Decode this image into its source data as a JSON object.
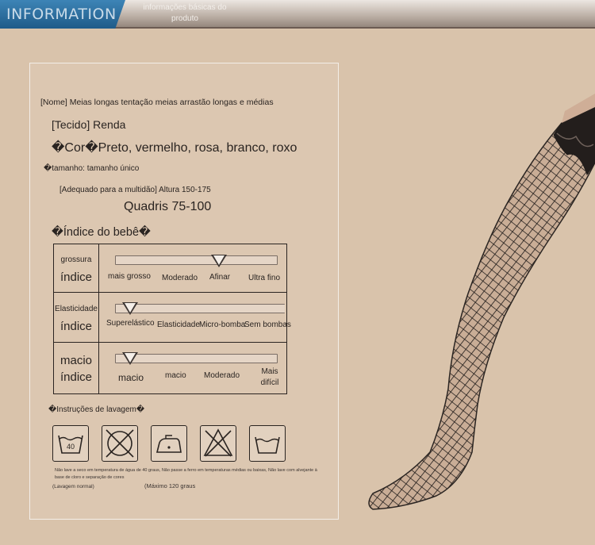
{
  "header": {
    "badge": "INFORMATION",
    "subtitle_line1": "informações básicas do",
    "subtitle_line2": "produto"
  },
  "product": {
    "name": "[Nome] Meias longas tentação meias arrastão longas e médias",
    "fabric": "[Tecido] Renda",
    "color": "�Cor�Preto, vermelho, rosa, branco, roxo",
    "size": "�tamanho: tamanho único",
    "crowd": "[Adequado para a multidão] Altura 150-175",
    "hips": "Quadris 75-100"
  },
  "baby_index": {
    "title": "�Índice do bebê�",
    "rows": [
      {
        "label_top": "grossura",
        "label_bottom": "índice",
        "options": [
          "mais grosso",
          "Moderado",
          "Afinar",
          "Ultra fino"
        ],
        "selected": 2
      },
      {
        "label_top": "Elasticidade",
        "label_bottom": "índice",
        "options": [
          "Superelástico",
          "Elasticidade",
          "Micro-bomba",
          "Sem bombas"
        ],
        "selected": 0
      },
      {
        "label_top": "macio",
        "label_bottom": "índice",
        "options": [
          "macio",
          "macio",
          "Moderado",
          "Mais difícil"
        ],
        "selected": 0
      }
    ]
  },
  "washing": {
    "title": "�Instruções de lavagem�",
    "icons": [
      "wash-40-icon",
      "no-dryclean-icon",
      "low-iron-icon",
      "no-bleach-icon",
      "hand-wash-icon"
    ],
    "wash_temp": "40",
    "note": "Não lave a seco em temperatura de água de 40 graus, Não passe a ferro em temperaturas médias ou baixas, Não lave com alvejante à base de cloro e separação de cores",
    "label_normal": "(Lavagem normal)",
    "label_max": "(Máximo 120 graus"
  }
}
